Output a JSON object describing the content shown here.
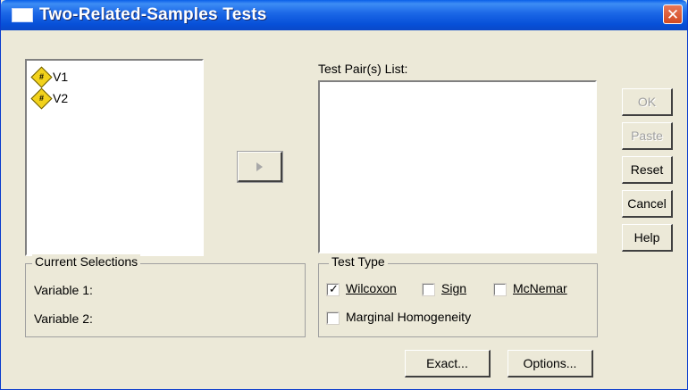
{
  "window": {
    "title": "Two-Related-Samples Tests"
  },
  "variables": [
    {
      "name": "V1"
    },
    {
      "name": "V2"
    }
  ],
  "test_pairs": {
    "label": "Test Pair(s) List:"
  },
  "buttons": {
    "ok": "OK",
    "paste": "Paste",
    "reset": "Reset",
    "cancel": "Cancel",
    "help": "Help",
    "exact": "Exact...",
    "options": "Options..."
  },
  "current_selections": {
    "title": "Current Selections",
    "variable1": "Variable 1:",
    "variable2": "Variable 2:"
  },
  "test_type": {
    "title": "Test Type",
    "wilcoxon": {
      "label": "Wilcoxon",
      "checked": true
    },
    "sign": {
      "label": "Sign",
      "checked": false
    },
    "mcnemar": {
      "label": "McNemar",
      "checked": false
    },
    "marginal": {
      "label": "Marginal Homogeneity",
      "checked": false
    }
  }
}
